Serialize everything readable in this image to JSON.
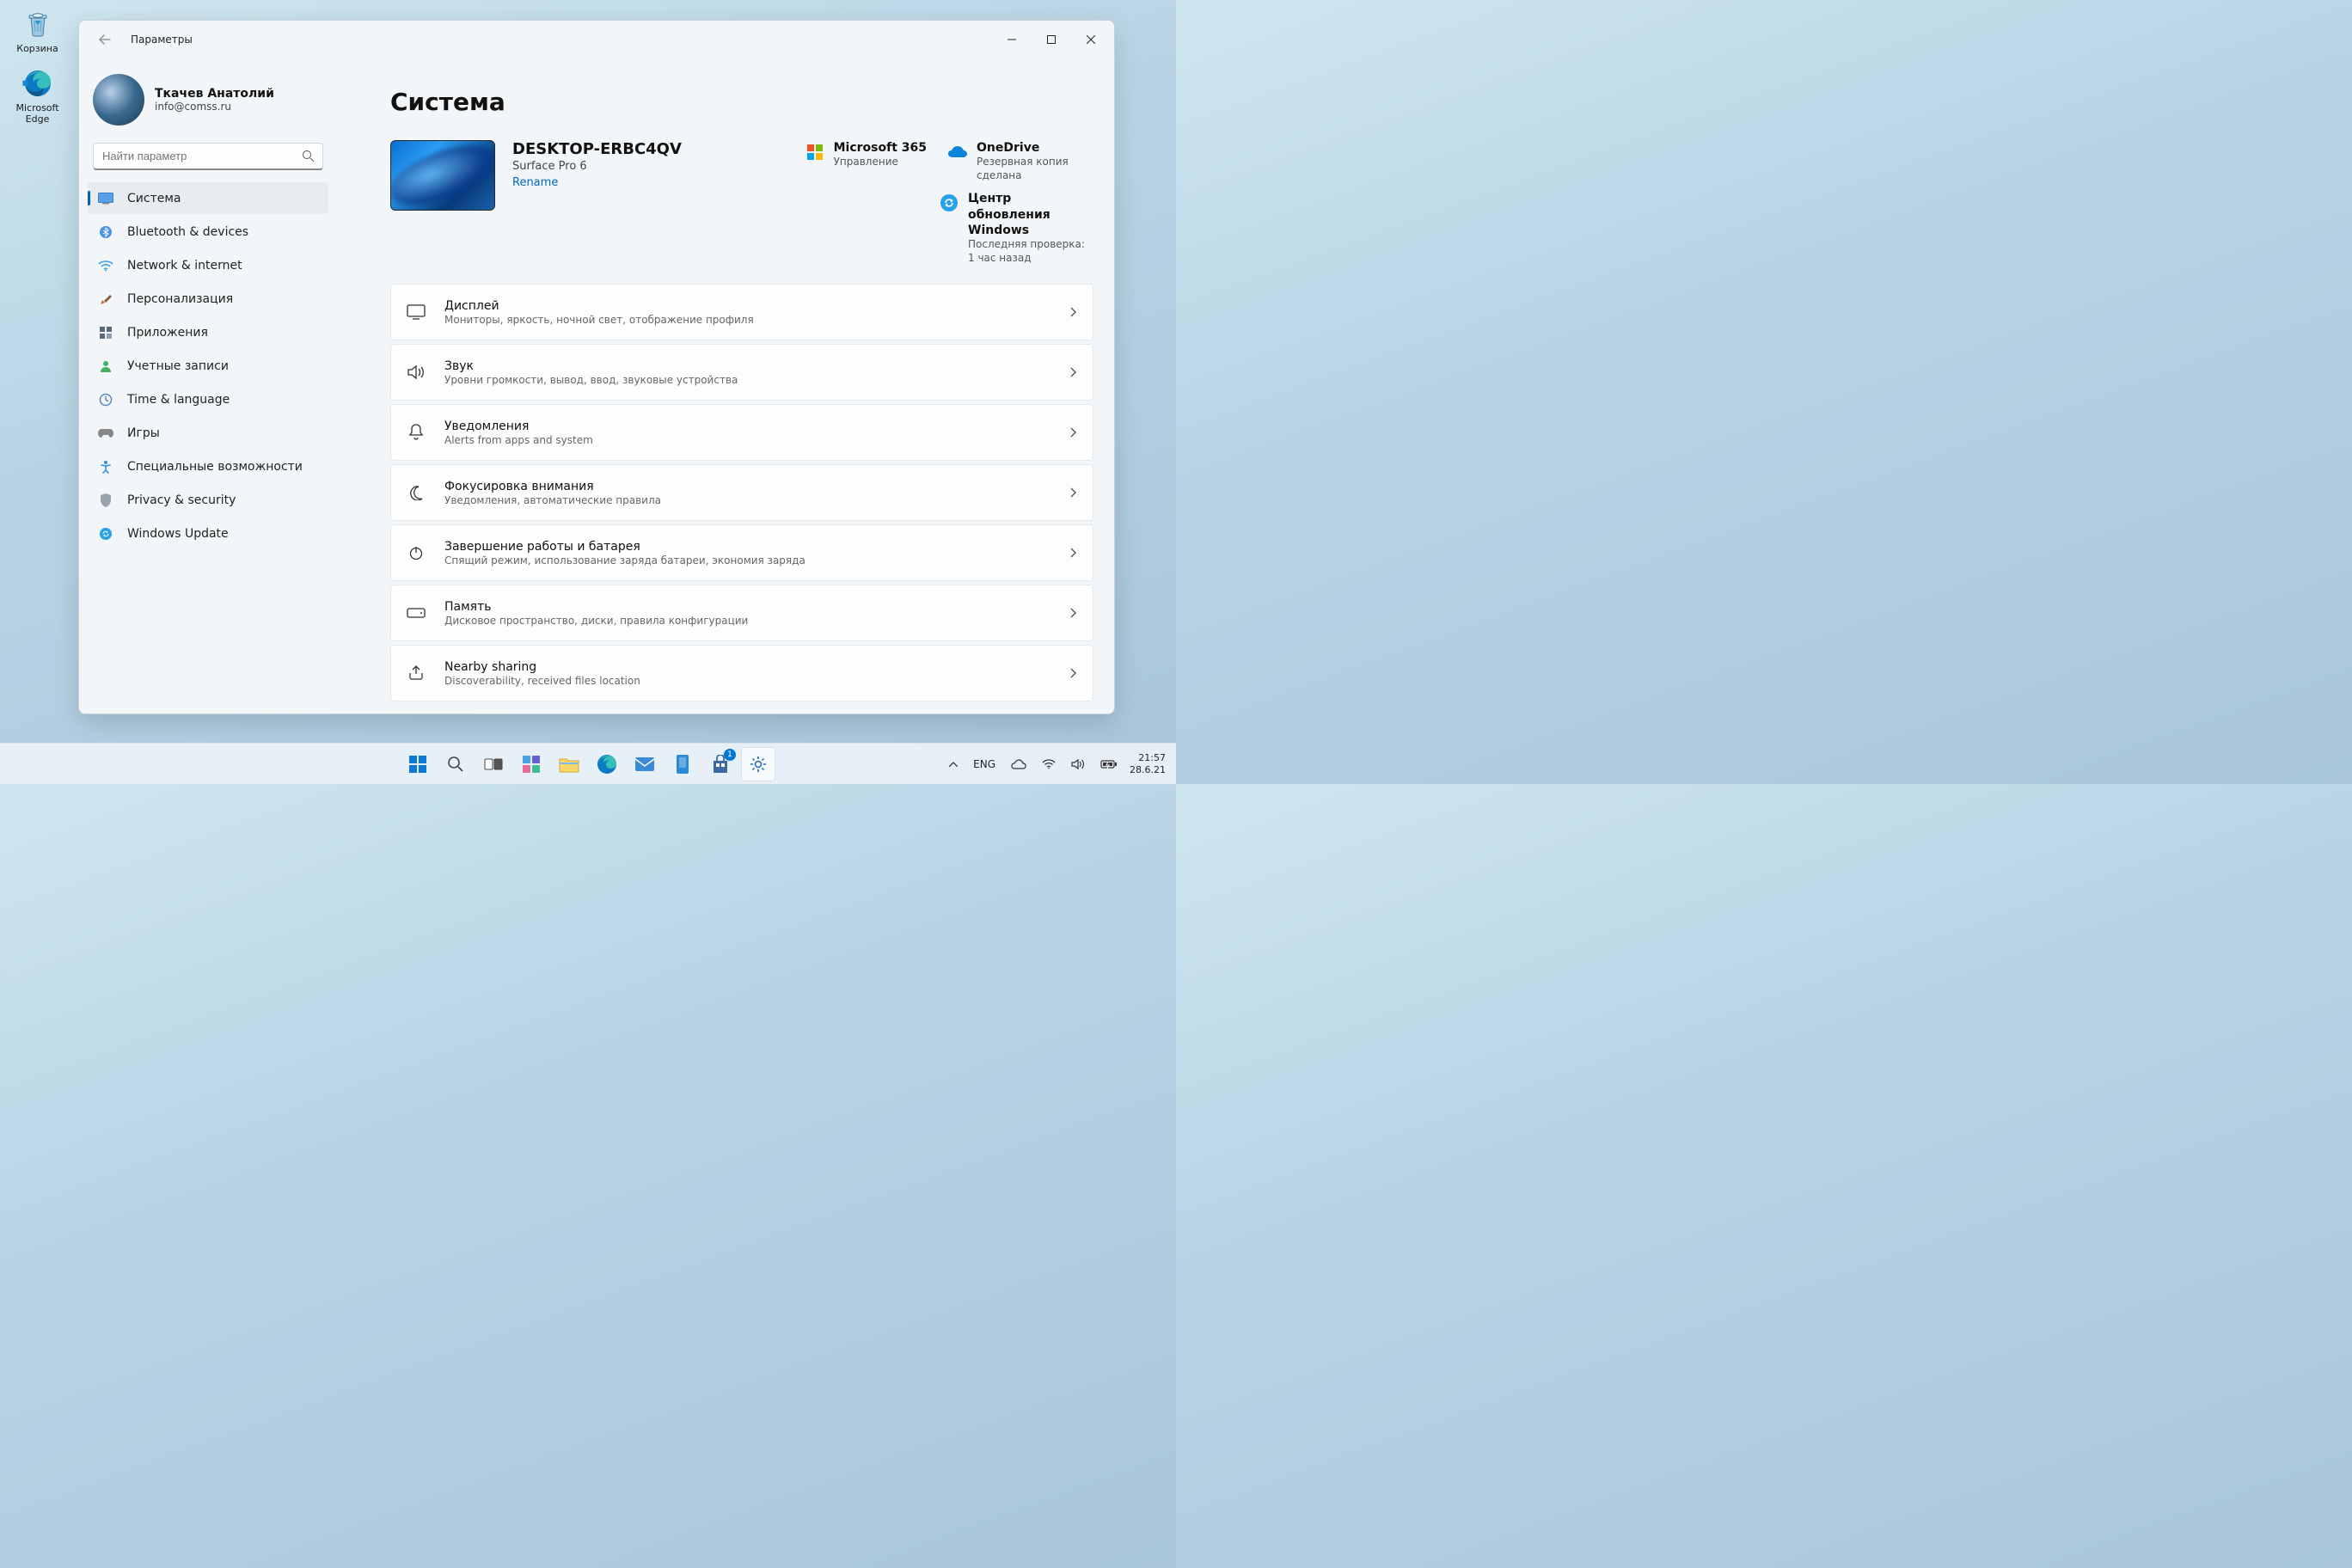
{
  "desktop": {
    "recycle_bin": "Корзина",
    "edge": "Microsoft\nEdge"
  },
  "window": {
    "title": "Параметры"
  },
  "account": {
    "name": "Ткачев Анатолий",
    "email": "info@comss.ru"
  },
  "search": {
    "placeholder": "Найти параметр"
  },
  "nav": {
    "items": [
      {
        "label": "Система"
      },
      {
        "label": "Bluetooth & devices"
      },
      {
        "label": "Network & internet"
      },
      {
        "label": "Персонализация"
      },
      {
        "label": "Приложения"
      },
      {
        "label": "Учетные записи"
      },
      {
        "label": "Time & language"
      },
      {
        "label": "Игры"
      },
      {
        "label": "Специальные возможности"
      },
      {
        "label": "Privacy & security"
      },
      {
        "label": "Windows Update"
      }
    ]
  },
  "page": {
    "title": "Система",
    "device": {
      "name": "DESKTOP-ERBC4QV",
      "model": "Surface Pro 6",
      "rename": "Rename"
    },
    "services": {
      "ms365": {
        "title": "Microsoft 365",
        "desc": "Управление"
      },
      "onedrive": {
        "title": "OneDrive",
        "desc": "Резервная копия сделана"
      },
      "update": {
        "title": "Центр обновления Windows",
        "desc": "Последняя проверка: 1 час назад"
      }
    },
    "cards": [
      {
        "title": "Дисплей",
        "desc": "Мониторы, яркость, ночной свет, отображение профиля"
      },
      {
        "title": "Звук",
        "desc": "Уровни громкости, вывод, ввод, звуковые устройства"
      },
      {
        "title": "Уведомления",
        "desc": "Alerts from apps and system"
      },
      {
        "title": "Фокусировка внимания",
        "desc": "Уведомления, автоматические правила"
      },
      {
        "title": "Завершение работы и батарея",
        "desc": "Спящий режим, использование заряда батареи, экономия заряда"
      },
      {
        "title": "Память",
        "desc": "Дисковое пространство, диски, правила конфигурации"
      },
      {
        "title": "Nearby sharing",
        "desc": "Discoverability, received files location"
      }
    ]
  },
  "taskbar": {
    "lang": "ENG",
    "time": "21:57",
    "date": "28.6.21",
    "store_badge": "1"
  }
}
